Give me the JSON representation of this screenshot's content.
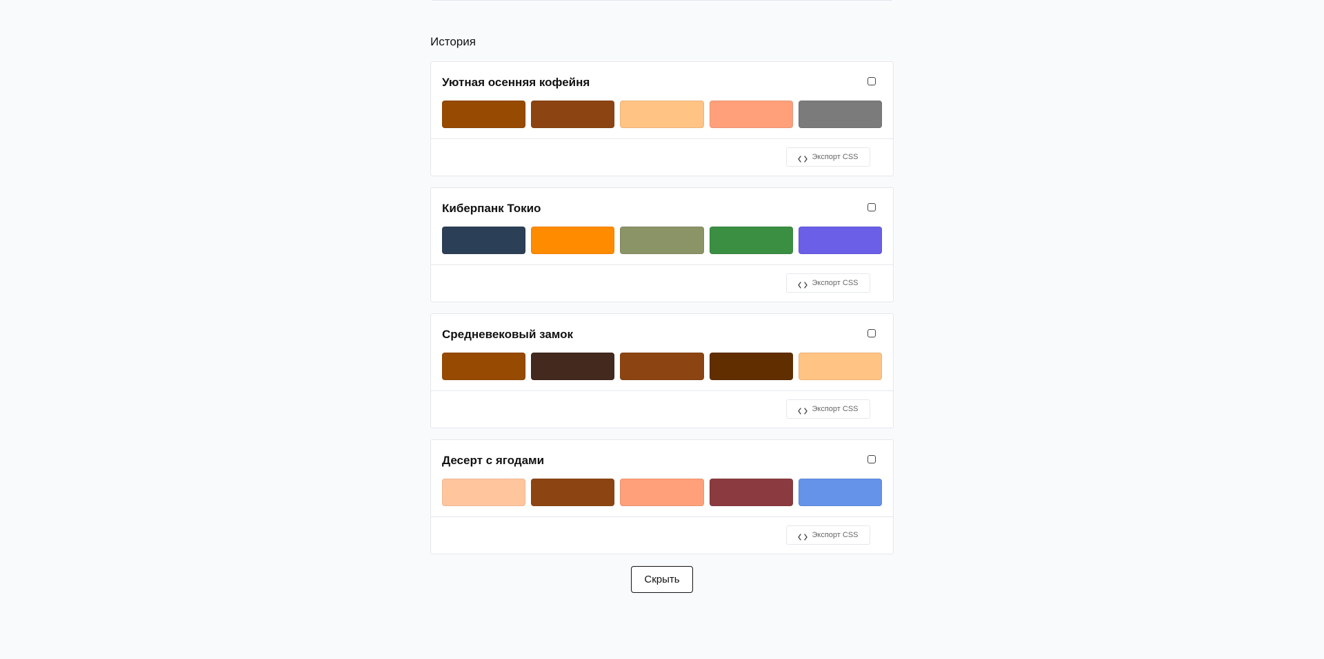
{
  "history": {
    "title": "История"
  },
  "palettes": [
    {
      "name": "Уютная осенняя кофейня",
      "colors": [
        "#974a01",
        "#8c4512",
        "#ffc384",
        "#ffa07a",
        "#7b7b7b"
      ],
      "export_label": "Экспорт CSS",
      "icons": [
        "code-icon"
      ]
    },
    {
      "name": "Киберпанк Токио",
      "colors": [
        "#2b3f56",
        "#ff8b01",
        "#8b9467",
        "#3b8f43",
        "#6b5ee7"
      ],
      "export_label": "Экспорт CSS",
      "icons": [
        "code-icon"
      ]
    },
    {
      "name": "Средневековый замок",
      "colors": [
        "#974a01",
        "#43291e",
        "#8c4512",
        "#612e00",
        "#ffc384"
      ],
      "export_label": "Экспорт CSS",
      "icons": [
        "code-icon"
      ]
    },
    {
      "name": "Десерт с ягодами",
      "colors": [
        "#ffc69e",
        "#8c4512",
        "#ffa07a",
        "#8b3a3f",
        "#6593e9"
      ],
      "export_label": "Экспорт CSS",
      "icons": [
        "code-icon"
      ]
    }
  ],
  "hide_button": {
    "label": "Скрыть"
  }
}
